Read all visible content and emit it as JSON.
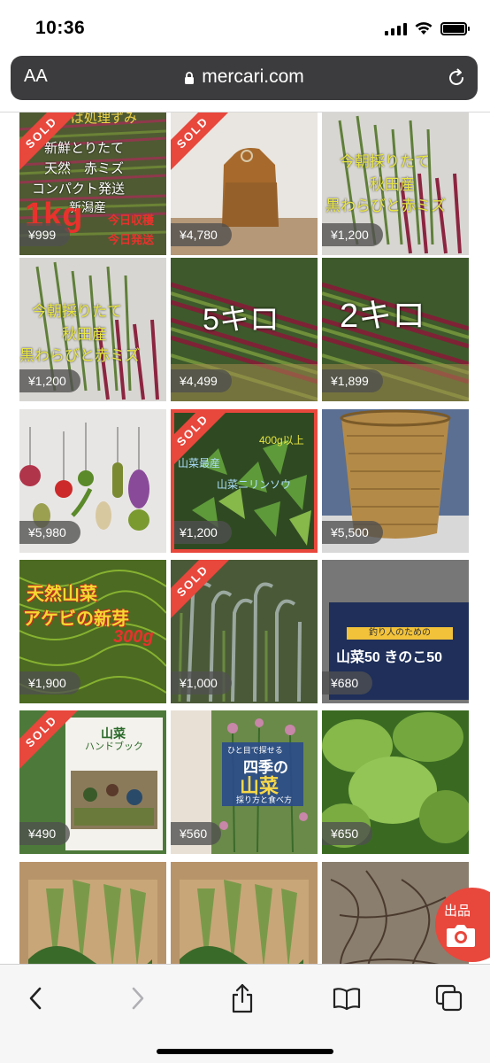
{
  "status_bar": {
    "time": "10:36",
    "icons": [
      "signal-icon",
      "wifi-icon",
      "battery-icon"
    ]
  },
  "browser": {
    "text_size_label": "AA",
    "url": "mercari.com",
    "lock_icon": "lock-icon",
    "reload_icon": "reload-icon"
  },
  "items": [
    {
      "price": "¥999",
      "sold": true,
      "image": "wild-vegetables-green-red-stems-with-text"
    },
    {
      "price": "¥4,780",
      "sold": true,
      "image": "brown-canvas-backpack"
    },
    {
      "price": "¥1,200",
      "sold": false,
      "image": "bracken-and-red-mizu-bundle-with-text"
    },
    {
      "price": "¥1,200",
      "sold": false,
      "image": "bracken-and-red-mizu-bundle-with-text"
    },
    {
      "price": "¥4,499",
      "sold": false,
      "image": "red-stem-bundles-5kg"
    },
    {
      "price": "¥1,899",
      "sold": false,
      "image": "red-stem-bundles-2kg"
    },
    {
      "price": "¥5,980",
      "sold": false,
      "image": "felt-vegetable-charms"
    },
    {
      "price": "¥1,200",
      "sold": true,
      "image": "leafy-wild-plant-in-forest"
    },
    {
      "price": "¥5,500",
      "sold": false,
      "image": "bamboo-basket"
    },
    {
      "price": "¥1,900",
      "sold": false,
      "image": "akebi-sprouts-300g"
    },
    {
      "price": "¥1,000",
      "sold": true,
      "image": "curled-fern-fiddleheads"
    },
    {
      "price": "¥680",
      "sold": false,
      "image": "book-sansai-50-kinoko-50"
    },
    {
      "price": "¥490",
      "sold": true,
      "image": "sansai-handbook"
    },
    {
      "price": "¥560",
      "sold": false,
      "image": "book-four-seasons-sansai"
    },
    {
      "price": "¥650",
      "sold": false,
      "image": "large-green-leaves"
    },
    {
      "price": "",
      "sold": false,
      "image": "bamboo-shoots-in-box"
    },
    {
      "price": "",
      "sold": false,
      "image": "bamboo-shoots-in-box"
    },
    {
      "price": "",
      "sold": false,
      "image": "dried-roots"
    }
  ],
  "sold_label": "SOLD",
  "image_text": {
    "tile1": [
      "ば処理ずみ",
      "新鮮とりたて",
      "天然　赤ミズ",
      "コンパクト発送",
      "新潟産",
      "1kg",
      "今日収穫",
      "今日発送"
    ],
    "tile3": [
      "今朝採りたて",
      "秋田産",
      "黒わらびと赤ミズ"
    ],
    "tile4": [
      "今朝採りたて",
      "秋田産",
      "黒わらびと赤ミズ"
    ],
    "tile5": [
      "5キロ"
    ],
    "tile6": [
      "2キロ"
    ],
    "tile8": [
      "400g以上",
      "山菜最産",
      "山菜ニリンソウ"
    ],
    "tile10": [
      "天然山菜",
      "アケビの新芽",
      "300g"
    ],
    "tile12": [
      "釣り人のための",
      "山菜50 きのこ50"
    ],
    "tile13": [
      "山菜",
      "ハンドブック"
    ],
    "tile14": [
      "ひと目で探せる",
      "四季の",
      "山菜",
      "採り方と食べ方"
    ]
  },
  "fab": {
    "label": "出品",
    "icon": "camera-icon"
  },
  "toolbar": {
    "buttons": [
      "back-icon",
      "forward-icon",
      "share-icon",
      "bookmarks-icon",
      "tabs-icon"
    ]
  },
  "colors": {
    "accent": "#e8473c",
    "url_bar": "#3c3c3e",
    "toolbar_bg": "#f6f6f7"
  }
}
